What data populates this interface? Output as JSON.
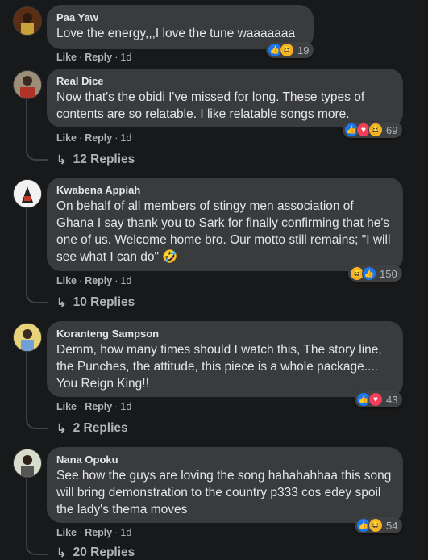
{
  "actions": {
    "like": "Like",
    "reply": "Reply",
    "dot": "·"
  },
  "comments": [
    {
      "author": "Paa Yaw",
      "text": "Love the energy,,,I love the tune waaaaaaa",
      "time": "1d",
      "reactions": [
        "like",
        "haha"
      ],
      "reaction_count": "19",
      "replies": null
    },
    {
      "author": "Real Dice",
      "text": "Now that's the obidi I've missed for long. These types of contents are so relatable. I like relatable songs more.",
      "time": "1d",
      "reactions": [
        "like",
        "love",
        "haha"
      ],
      "reaction_count": "69",
      "replies": "12 Replies"
    },
    {
      "author": "Kwabena Appiah",
      "text": "On behalf of all members of stingy men association of Ghana I say thank you to Sark for finally confirming that he's one of us. Welcome home bro. Our motto still remains; \"I will see what I can do\" 🤣",
      "time": "1d",
      "reactions": [
        "haha",
        "like"
      ],
      "reaction_count": "150",
      "replies": "10 Replies"
    },
    {
      "author": "Koranteng Sampson",
      "text": "Demm, how many times should I watch this, The story line, the Punches, the attitude, this piece is a whole package.... You Reign King!!",
      "time": "1d",
      "reactions": [
        "like",
        "love"
      ],
      "reaction_count": "43",
      "replies": "2 Replies"
    },
    {
      "author": "Nana Opoku",
      "text": "See how the guys are loving the song hahahahhaa this song will bring demonstration to the country p333 cos edey spoil the lady's thema moves",
      "time": "1d",
      "reactions": [
        "like",
        "haha"
      ],
      "reaction_count": "54",
      "replies": "20 Replies"
    }
  ],
  "colors": {
    "like": "#1877f2",
    "love": "#f33e58",
    "haha": "#f7b125",
    "bubble": "#3a3b3c",
    "background": "#18191a"
  }
}
